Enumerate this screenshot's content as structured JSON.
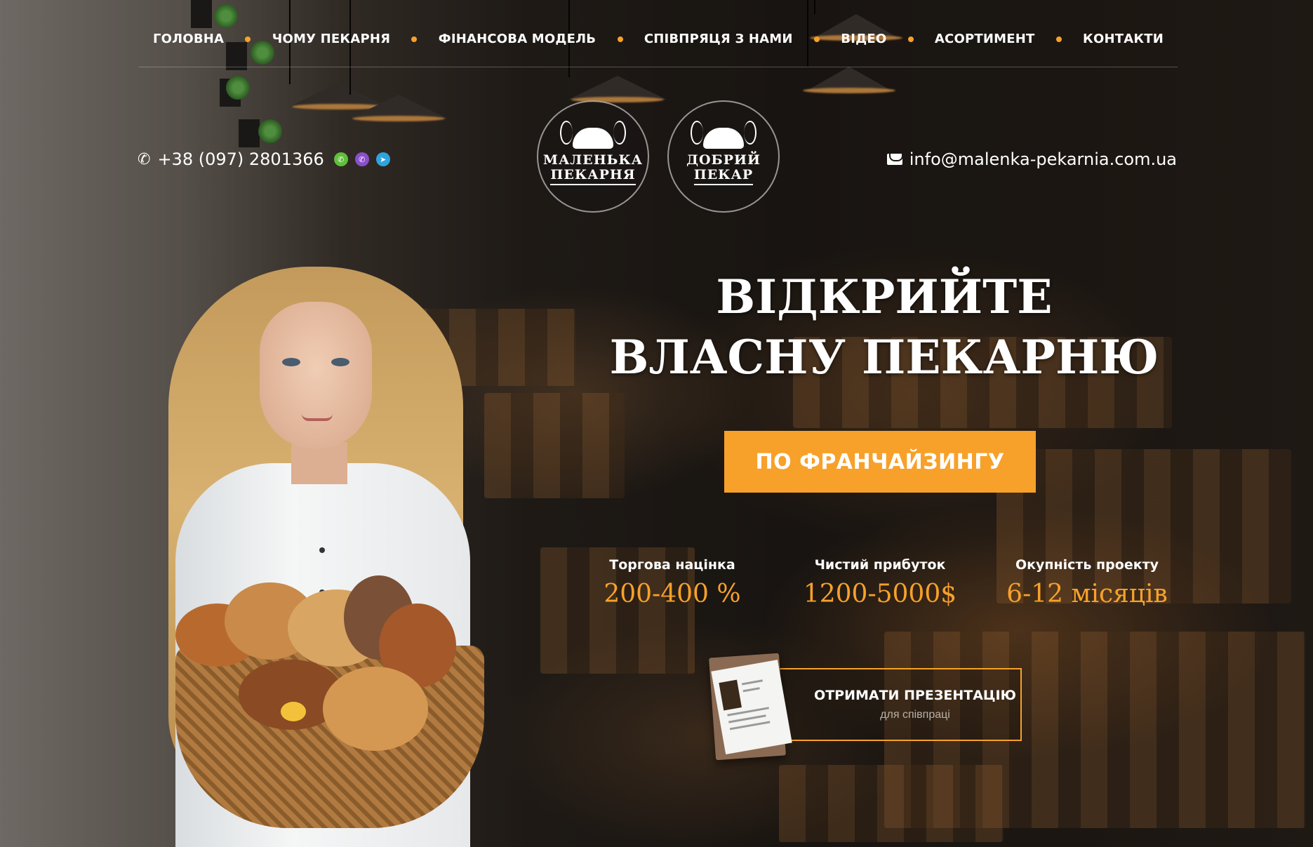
{
  "nav": {
    "items": [
      "ГОЛОВНА",
      "ЧОМУ ПЕКАРНЯ",
      "ФІНАНСОВА МОДЕЛЬ",
      "СПІВПРЯЦЯ З НАМИ",
      "ВІДЕО",
      "АСОРТИМЕНТ",
      "КОНТАКТИ"
    ]
  },
  "contacts": {
    "phone": "+38 (097) 2801366",
    "email": "info@malenka-pekarnia.com.ua",
    "messengers": [
      "whatsapp-icon",
      "viber-icon",
      "telegram-icon"
    ]
  },
  "logos": [
    {
      "line1": "МАЛЕНЬКА",
      "line2": "ПЕКАРНЯ"
    },
    {
      "line1": "ДОБРИЙ",
      "line2": "ПЕКАР"
    }
  ],
  "hero": {
    "title_line1": "ВІДКРИЙТЕ",
    "title_line2": "ВЛАСНУ ПЕКАРНЮ",
    "cta": "ПО ФРАНЧАЙЗИНГУ"
  },
  "stats": [
    {
      "label": "Торгова націнка",
      "value": "200-400 %"
    },
    {
      "label": "Чистий прибуток",
      "value": "1200-5000$"
    },
    {
      "label": "Окупність проекту",
      "value": "6-12 місяців"
    }
  ],
  "presentation": {
    "title": "ОТРИМАТИ ПРЕЗЕНТАЦІЮ",
    "subtitle": "для співпраці"
  },
  "colors": {
    "accent": "#f7a12a",
    "background": "#1b1714",
    "text": "#ffffff"
  }
}
